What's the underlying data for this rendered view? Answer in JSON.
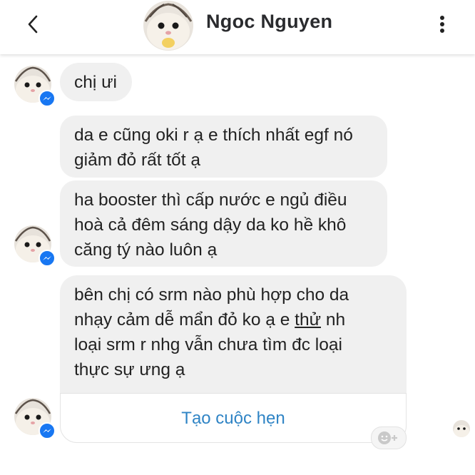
{
  "header": {
    "contact_name": "Ngoc Nguyen",
    "back_icon": "chevron-left-icon",
    "menu_icon": "more-vertical-icon"
  },
  "messages": [
    {
      "text": "chị ưi"
    },
    {
      "lines": [
        "da e cũng oki r ạ e thích nhất egf nó",
        "giảm đỏ rất tốt ạ"
      ]
    },
    {
      "lines": [
        "ha booster thì cấp nước e ngủ điều",
        "hoà cả đêm sáng dậy da ko hề khô",
        "căng tý nào luôn ạ"
      ]
    },
    {
      "line1": "bên chị có srm nào phù hợp cho da",
      "line2_pre": "nhạy cảm dễ mẩn đỏ ko ạ e ",
      "line2_underlined": "thử",
      "line2_post": " nh",
      "line3": "loại srm r nhg vẫn chưa tìm đc loại",
      "line4": "thực sự ưng ạ"
    }
  ],
  "appointment": {
    "label": "Tạo cuộc hẹn"
  },
  "colors": {
    "bubble": "#f0f0f0",
    "link": "#2f84c5",
    "messenger_badge": "#1877f2"
  }
}
